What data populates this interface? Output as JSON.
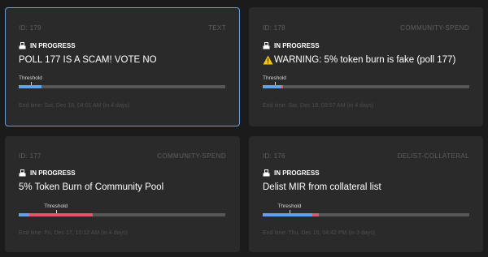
{
  "colors": {
    "background": "#1b1b1b",
    "card": "#2a2a2a",
    "selected_border": "#6f9fd8",
    "yes": "#5fa3ee",
    "no": "#e3556a",
    "abstain": "#575757"
  },
  "icons": {
    "status": "ballot-box-icon",
    "warning": "warning-icon"
  },
  "threshold_label": "Threshold",
  "polls": [
    {
      "id_label": "ID: 179",
      "type": "TEXT",
      "status": "IN PROGRESS",
      "title": "POLL 177 IS A SCAM! VOTE NO",
      "has_warning": false,
      "end_time": "End time: Sat, Dec 18, 04:01 AM (in 4 days)",
      "selected": true,
      "threshold": 0.06,
      "votes": {
        "yes": 0.11,
        "no": 0.0
      }
    },
    {
      "id_label": "ID: 178",
      "type": "COMMUNITY-SPEND",
      "status": "IN PROGRESS",
      "title": "WARNING: 5% token burn is fake (poll 177)",
      "has_warning": true,
      "end_time": "End time: Sat, Dec 18, 03:57 AM (in 4 days)",
      "selected": false,
      "threshold": 0.06,
      "votes": {
        "yes": 0.09,
        "no": 0.01
      }
    },
    {
      "id_label": "ID: 177",
      "type": "COMMUNITY-SPEND",
      "status": "IN PROGRESS",
      "title": "5% Token Burn of Community Pool",
      "has_warning": false,
      "end_time": "End time: Fri, Dec 17, 10:12 AM (in 4 days)",
      "selected": false,
      "threshold": 0.18,
      "votes": {
        "yes": 0.05,
        "no": 0.31
      }
    },
    {
      "id_label": "ID: 176",
      "type": "DELIST-COLLATERAL",
      "status": "IN PROGRESS",
      "title": "Delist MIR from collateral list",
      "has_warning": false,
      "end_time": "End time: Thu, Dec 16, 04:42 PM (in 3 days)",
      "selected": false,
      "threshold": 0.13,
      "votes": {
        "yes": 0.24,
        "no": 0.03
      }
    }
  ]
}
